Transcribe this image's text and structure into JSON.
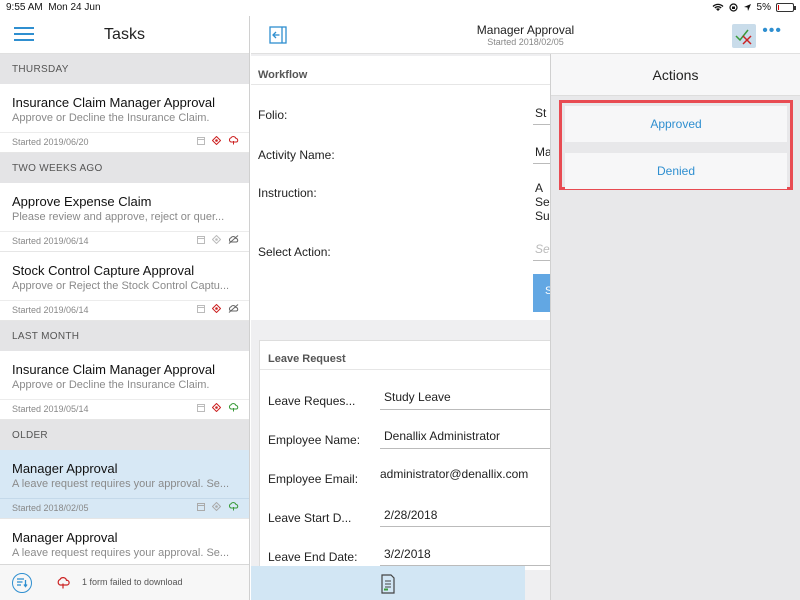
{
  "status_bar": {
    "time": "9:55 AM",
    "date": "Mon 24 Jun",
    "battery": "5%",
    "battery_color": "#dd0000"
  },
  "tasks_pane": {
    "title": "Tasks",
    "sections": [
      {
        "header": "THURSDAY",
        "items": [
          {
            "title": "Insurance Claim Manager Approval",
            "desc": "Approve or Decline the Insurance Claim.",
            "started": "Started 2019/06/20",
            "icons": [
              "form-icon",
              "priority-icon",
              "cloud-error-icon"
            ]
          }
        ]
      },
      {
        "header": "TWO WEEKS AGO",
        "items": [
          {
            "title": "Approve Expense Claim",
            "desc": "Please review and approve, reject or quer...",
            "started": "Started 2019/06/14",
            "icons": [
              "form-icon",
              "priority-icon",
              "offline-icon"
            ]
          },
          {
            "title": "Stock Control Capture Approval",
            "desc": "Approve or Reject the Stock Control Captu...",
            "started": "Started 2019/06/14",
            "icons": [
              "form-icon",
              "priority-icon",
              "offline-icon"
            ]
          }
        ]
      },
      {
        "header": "LAST MONTH",
        "items": [
          {
            "title": "Insurance Claim Manager Approval",
            "desc": "Approve or Decline the Insurance Claim.",
            "started": "Started 2019/05/14",
            "icons": [
              "form-icon",
              "priority-icon",
              "cloud-ok-icon"
            ]
          }
        ]
      },
      {
        "header": "OLDER",
        "items": [
          {
            "title": "Manager Approval",
            "desc": "A leave request requires your approval. Se...",
            "started": "Started 2018/02/05",
            "icons": [
              "form-icon",
              "priority-icon",
              "cloud-ok-icon"
            ],
            "selected": true
          },
          {
            "title": "Manager Approval",
            "desc": "A leave request requires your approval. Se...",
            "started": "",
            "icons": []
          }
        ]
      }
    ],
    "footer": {
      "failed_text": "1 form failed to download"
    }
  },
  "detail": {
    "title": "Manager Approval",
    "subtitle": "Started 2018/02/05",
    "workflow": {
      "heading": "Workflow",
      "folio_label": "Folio:",
      "folio_value": "St",
      "activity_label": "Activity Name:",
      "activity_value": "Ma",
      "instruction_label": "Instruction:",
      "instruction_lines": [
        "A",
        "Se",
        "Su"
      ],
      "select_action_label": "Select Action:",
      "select_action_placeholder": "Se",
      "submit_label": "S"
    },
    "leave_request": {
      "heading": "Leave Request",
      "fields": [
        {
          "label": "Leave Reques...",
          "value": "Study Leave"
        },
        {
          "label": "Employee Name:",
          "value": "Denallix Administrator"
        },
        {
          "label": "Employee Email:",
          "value": "administrator@denallix.com"
        },
        {
          "label": "Leave Start D...",
          "value": "2/28/2018"
        },
        {
          "label": "Leave End Date:",
          "value": "3/2/2018"
        }
      ]
    }
  },
  "actions_panel": {
    "title": "Actions",
    "items": [
      "Approved",
      "Denied"
    ],
    "highlight_color": "#e84b52"
  },
  "colors": {
    "accent": "#2f8fd0",
    "selected_row": "#d7e8f5",
    "error": "#cc2222",
    "ok": "#3a9a3a"
  }
}
